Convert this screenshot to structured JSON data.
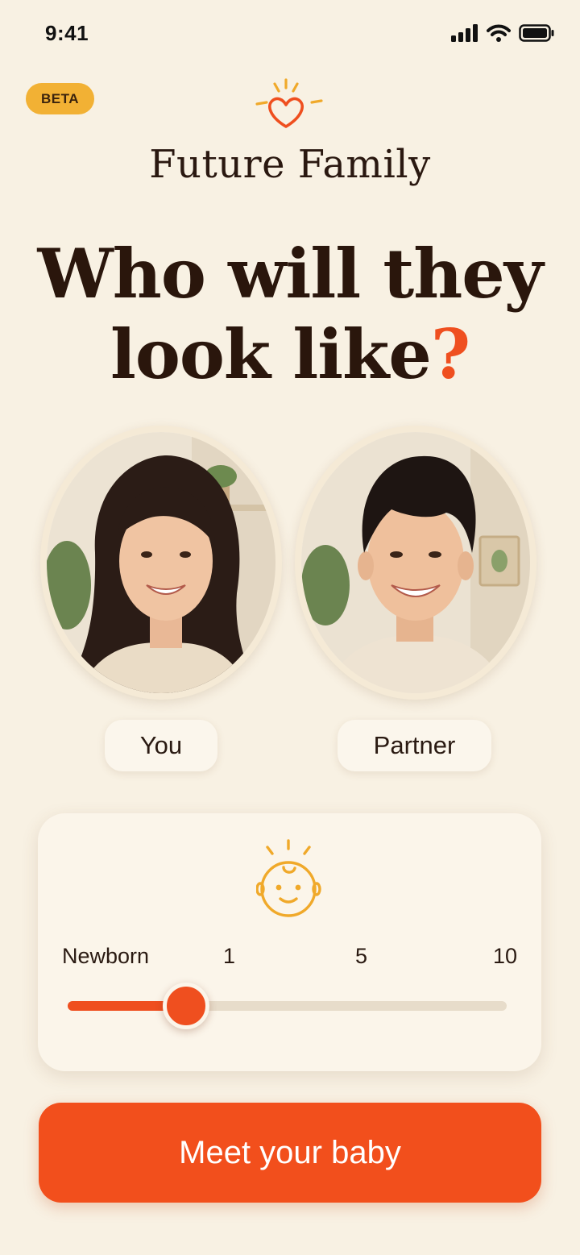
{
  "status_bar": {
    "time": "9:41",
    "icons": [
      "signal-icon",
      "wifi-icon",
      "battery-icon"
    ]
  },
  "header": {
    "badge": "BETA",
    "logo_icon": "heart-sparkle-icon",
    "app_name": "Future Family"
  },
  "headline": {
    "line1": "Who will they",
    "line2": "look like",
    "mark": "?"
  },
  "parents": [
    {
      "label": "You",
      "photo": "woman-smiling-photo"
    },
    {
      "label": "Partner",
      "photo": "man-smiling-photo"
    }
  ],
  "age_selector": {
    "icon": "baby-face-icon",
    "labels": [
      "Newborn",
      "1",
      "5",
      "10"
    ],
    "selected_fraction": 0.27
  },
  "cta": {
    "label": "Meet your baby"
  },
  "colors": {
    "background": "#f8f1e3",
    "accent": "#ef4f1f",
    "badge": "#f2b134",
    "icon_gold": "#f0a92a",
    "text": "#2a160c"
  }
}
